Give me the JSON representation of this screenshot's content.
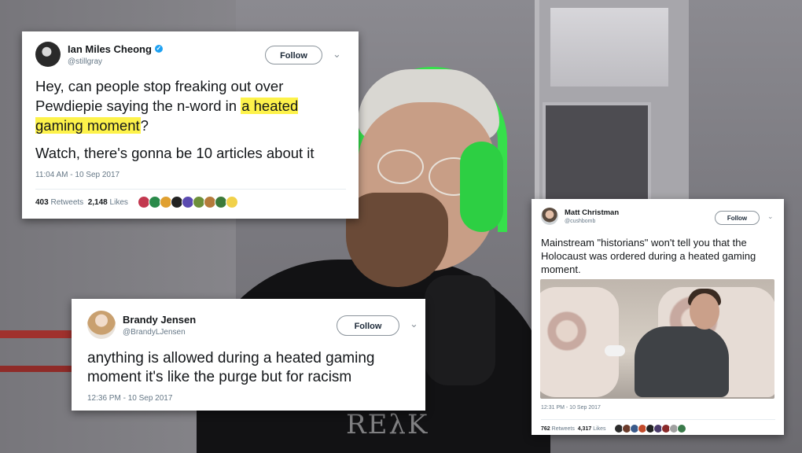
{
  "colors": {
    "highlight": "#fdf24a",
    "verified": "#1da1f2",
    "headset_green": "#36e04b"
  },
  "tweets": [
    {
      "display_name": "Ian Miles Cheong",
      "handle": "@stillgray",
      "verified": true,
      "follow_label": "Follow",
      "text_1a": "Hey, can people stop freaking out over Pewdiepie saying the n-word in ",
      "text_1_highlight": "a heated gaming moment",
      "text_1b": "?",
      "text_2": "Watch, there's gonna be 10 articles about it",
      "timestamp": "11:04 AM - 10 Sep 2017",
      "retweets": "403",
      "retweets_label": "Retweets",
      "likes": "2,148",
      "likes_label": "Likes",
      "liker_avatars": [
        "#c2384f",
        "#2a8a4a",
        "#e0a030",
        "#222222",
        "#5a4ab0",
        "#6d8f3a",
        "#b57a3b",
        "#3c7a3a",
        "#f1d14a"
      ]
    },
    {
      "display_name": "Brandy Jensen",
      "handle": "@BrandyLJensen",
      "verified": false,
      "follow_label": "Follow",
      "text": "anything is allowed during a heated gaming moment it's like the purge but for racism",
      "timestamp": "12:36 PM - 10 Sep 2017"
    },
    {
      "display_name": "Matt Christman",
      "handle": "@cushbomb",
      "verified": false,
      "follow_label": "Follow",
      "text": "Mainstream \"historians\" won't tell you that the Holocaust was ordered during a heated gaming moment.",
      "timestamp": "12:31 PM - 10 Sep 2017",
      "retweets": "762",
      "retweets_label": "Retweets",
      "likes": "4,317",
      "likes_label": "Likes",
      "liker_avatars": [
        "#2b2b2b",
        "#6b3b2b",
        "#3a5a8a",
        "#c24a2a",
        "#222222",
        "#4a3a6a",
        "#8a2a2a",
        "#a0a0a0",
        "#3a7a4a"
      ]
    }
  ],
  "background": {
    "shirt_text": "REλK"
  }
}
